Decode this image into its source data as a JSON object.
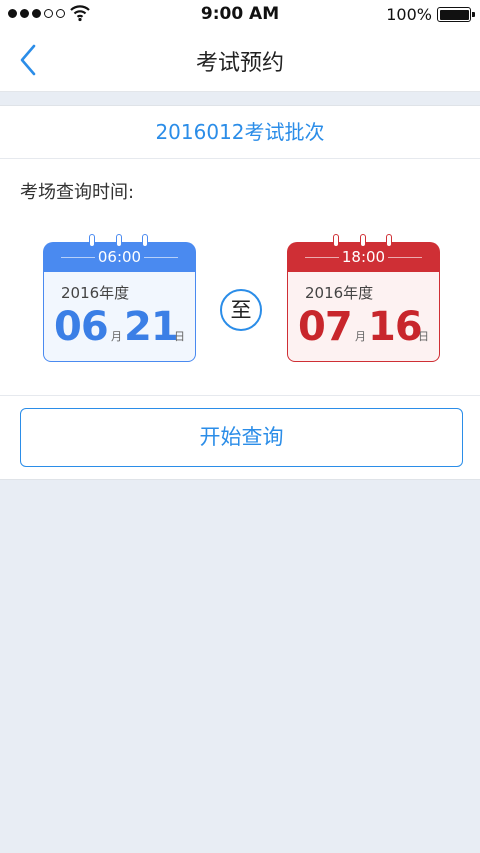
{
  "status_bar": {
    "time": "9:00 AM",
    "battery": "100%"
  },
  "nav": {
    "title": "考试预约",
    "back_icon": "chevron-left-icon"
  },
  "batch": {
    "label": "2016012考试批次"
  },
  "query": {
    "label": "考场查询时间:",
    "separator": "至",
    "start": {
      "time": "06:00",
      "year": "2016年度",
      "month": "06",
      "month_unit": "月",
      "day": "21",
      "day_unit": "日"
    },
    "end": {
      "time": "18:00",
      "year": "2016年度",
      "month": "07",
      "month_unit": "月",
      "day": "16",
      "day_unit": "日"
    }
  },
  "actions": {
    "start_query": "开始查询"
  },
  "colors": {
    "accent": "#2b8de8",
    "start_calendar": "#4a8af0",
    "end_calendar": "#cf2f35",
    "background": "#e8edf4"
  }
}
